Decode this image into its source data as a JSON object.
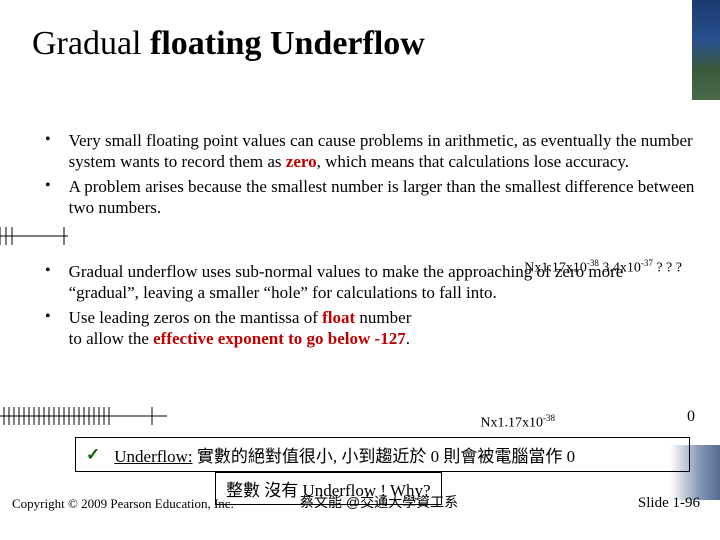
{
  "title": {
    "part1": "Gradual ",
    "part2": "floating Underflow"
  },
  "bullets": {
    "b1_a": "Very small floating point values can cause problems in arithmetic, as eventually the number system wants to record them as ",
    "b1_zero": "zero",
    "b1_b": ", which means that calculations lose accuracy.",
    "b2": "A problem arises because the smallest number is larger than the smallest difference between two numbers.",
    "b3": "Gradual underflow uses sub-normal values to make the approaching of zero more “gradual”, leaving a smaller “hole” for calculations to fall into.",
    "b4_a": "Use leading zeros on the mantissa of ",
    "b4_float": "float",
    "b4_b": " number",
    "b4_c": "to allow the ",
    "b4_eff": "effective exponent to go below -127",
    "b4_d": "."
  },
  "nline": {
    "n1": "Nx1.17x10",
    "e1": "-38",
    "n2": "   3.4x10",
    "e2": "-37",
    "q": " ? ? ?",
    "zero": "0"
  },
  "box1": {
    "label": "Underflow:",
    "text": " 實數的絕對值很小, 小到趨近於 0 則會被電腦當作 0"
  },
  "box2": "整數 沒有 Underflow ! Why?",
  "footer": {
    "copyright": "Copyright © 2009 Pearson Education, Inc.",
    "author": "蔡文能 @交通大學資工系",
    "slide": "Slide 1-96"
  }
}
